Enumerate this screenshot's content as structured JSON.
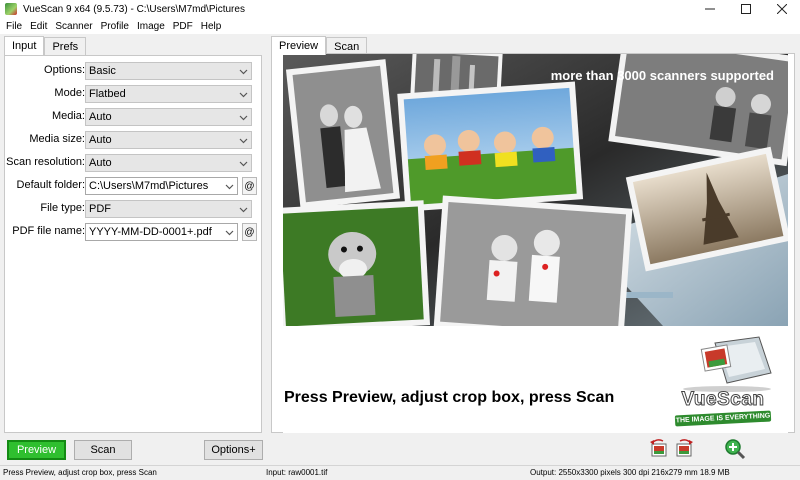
{
  "window": {
    "title": "VueScan 9 x64 (9.5.73) - C:\\Users\\M7md\\Pictures",
    "minimize": "—",
    "maximize": "☐",
    "close": "✕"
  },
  "menu": [
    "File",
    "Edit",
    "Scanner",
    "Profile",
    "Image",
    "PDF",
    "Help"
  ],
  "left_tabs": [
    "Input",
    "Prefs"
  ],
  "form": {
    "options": {
      "label": "Options:",
      "value": "Basic"
    },
    "mode": {
      "label": "Mode:",
      "value": "Flatbed"
    },
    "media": {
      "label": "Media:",
      "value": "Auto"
    },
    "media_size": {
      "label": "Media size:",
      "value": "Auto"
    },
    "scan_resolution": {
      "label": "Scan resolution:",
      "value": "Auto"
    },
    "default_folder": {
      "label": "Default folder:",
      "value": "C:\\Users\\M7md\\Pictures",
      "button": "@"
    },
    "file_type": {
      "label": "File type:",
      "value": "PDF"
    },
    "pdf_file_name": {
      "label": "PDF file name:",
      "value": "YYYY-MM-DD-0001+.pdf",
      "button": "@"
    }
  },
  "right_tabs": [
    "Preview",
    "Scan"
  ],
  "preview": {
    "tagline": "more than 3000 scanners supported",
    "instruction": "Press Preview, adjust crop box, press Scan",
    "logo_word": "VueScan",
    "logo_slogan": "THE IMAGE IS EVERYTHING"
  },
  "buttons": {
    "preview": "Preview",
    "scan": "Scan",
    "options": "Options+"
  },
  "status": {
    "left": "Press Preview, adjust crop box, press Scan",
    "middle": "Input: raw0001.tif",
    "right": "Output: 2550x3300 pixels 300 dpi 216x279 mm 18.9 MB"
  },
  "colors": {
    "preview_button": "#2fbf2f",
    "window_bg": "#f0f0f0",
    "panel_bg": "#ffffff"
  }
}
